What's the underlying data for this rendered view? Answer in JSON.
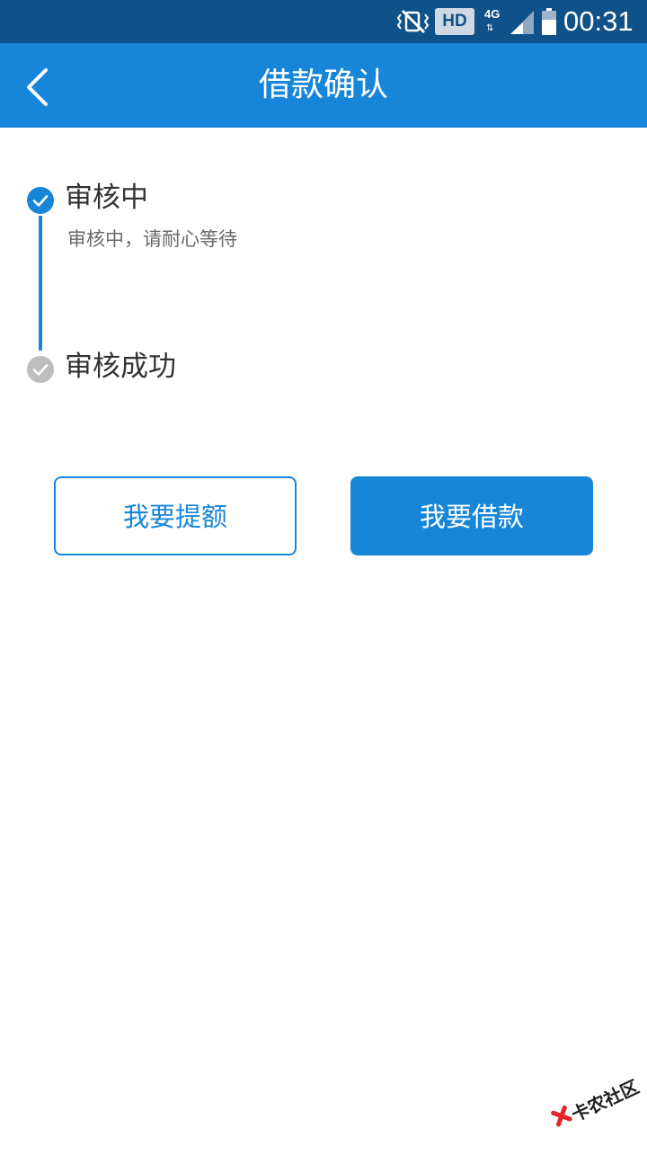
{
  "status_bar": {
    "hd_label": "HD",
    "network_label": "4G",
    "network_arrows": "⇅",
    "time": "00:31",
    "icons": [
      "vibrate-mute-icon",
      "signal-icon",
      "battery-icon"
    ]
  },
  "nav": {
    "back_icon": "chevron-left-icon",
    "title": "借款确认"
  },
  "steps": [
    {
      "title": "审核中",
      "description": "审核中，请耐心等待",
      "status": "done"
    },
    {
      "title": "审核成功",
      "status": "pending"
    }
  ],
  "actions": {
    "raise_limit_label": "我要提额",
    "borrow_label": "我要借款"
  },
  "watermark": {
    "text": "卡农社区"
  },
  "colors": {
    "status_bar": "#0f5189",
    "primary": "#1786d8",
    "pending": "#bdbdbd",
    "text": "#333333",
    "text_secondary": "#6a6a6a"
  }
}
